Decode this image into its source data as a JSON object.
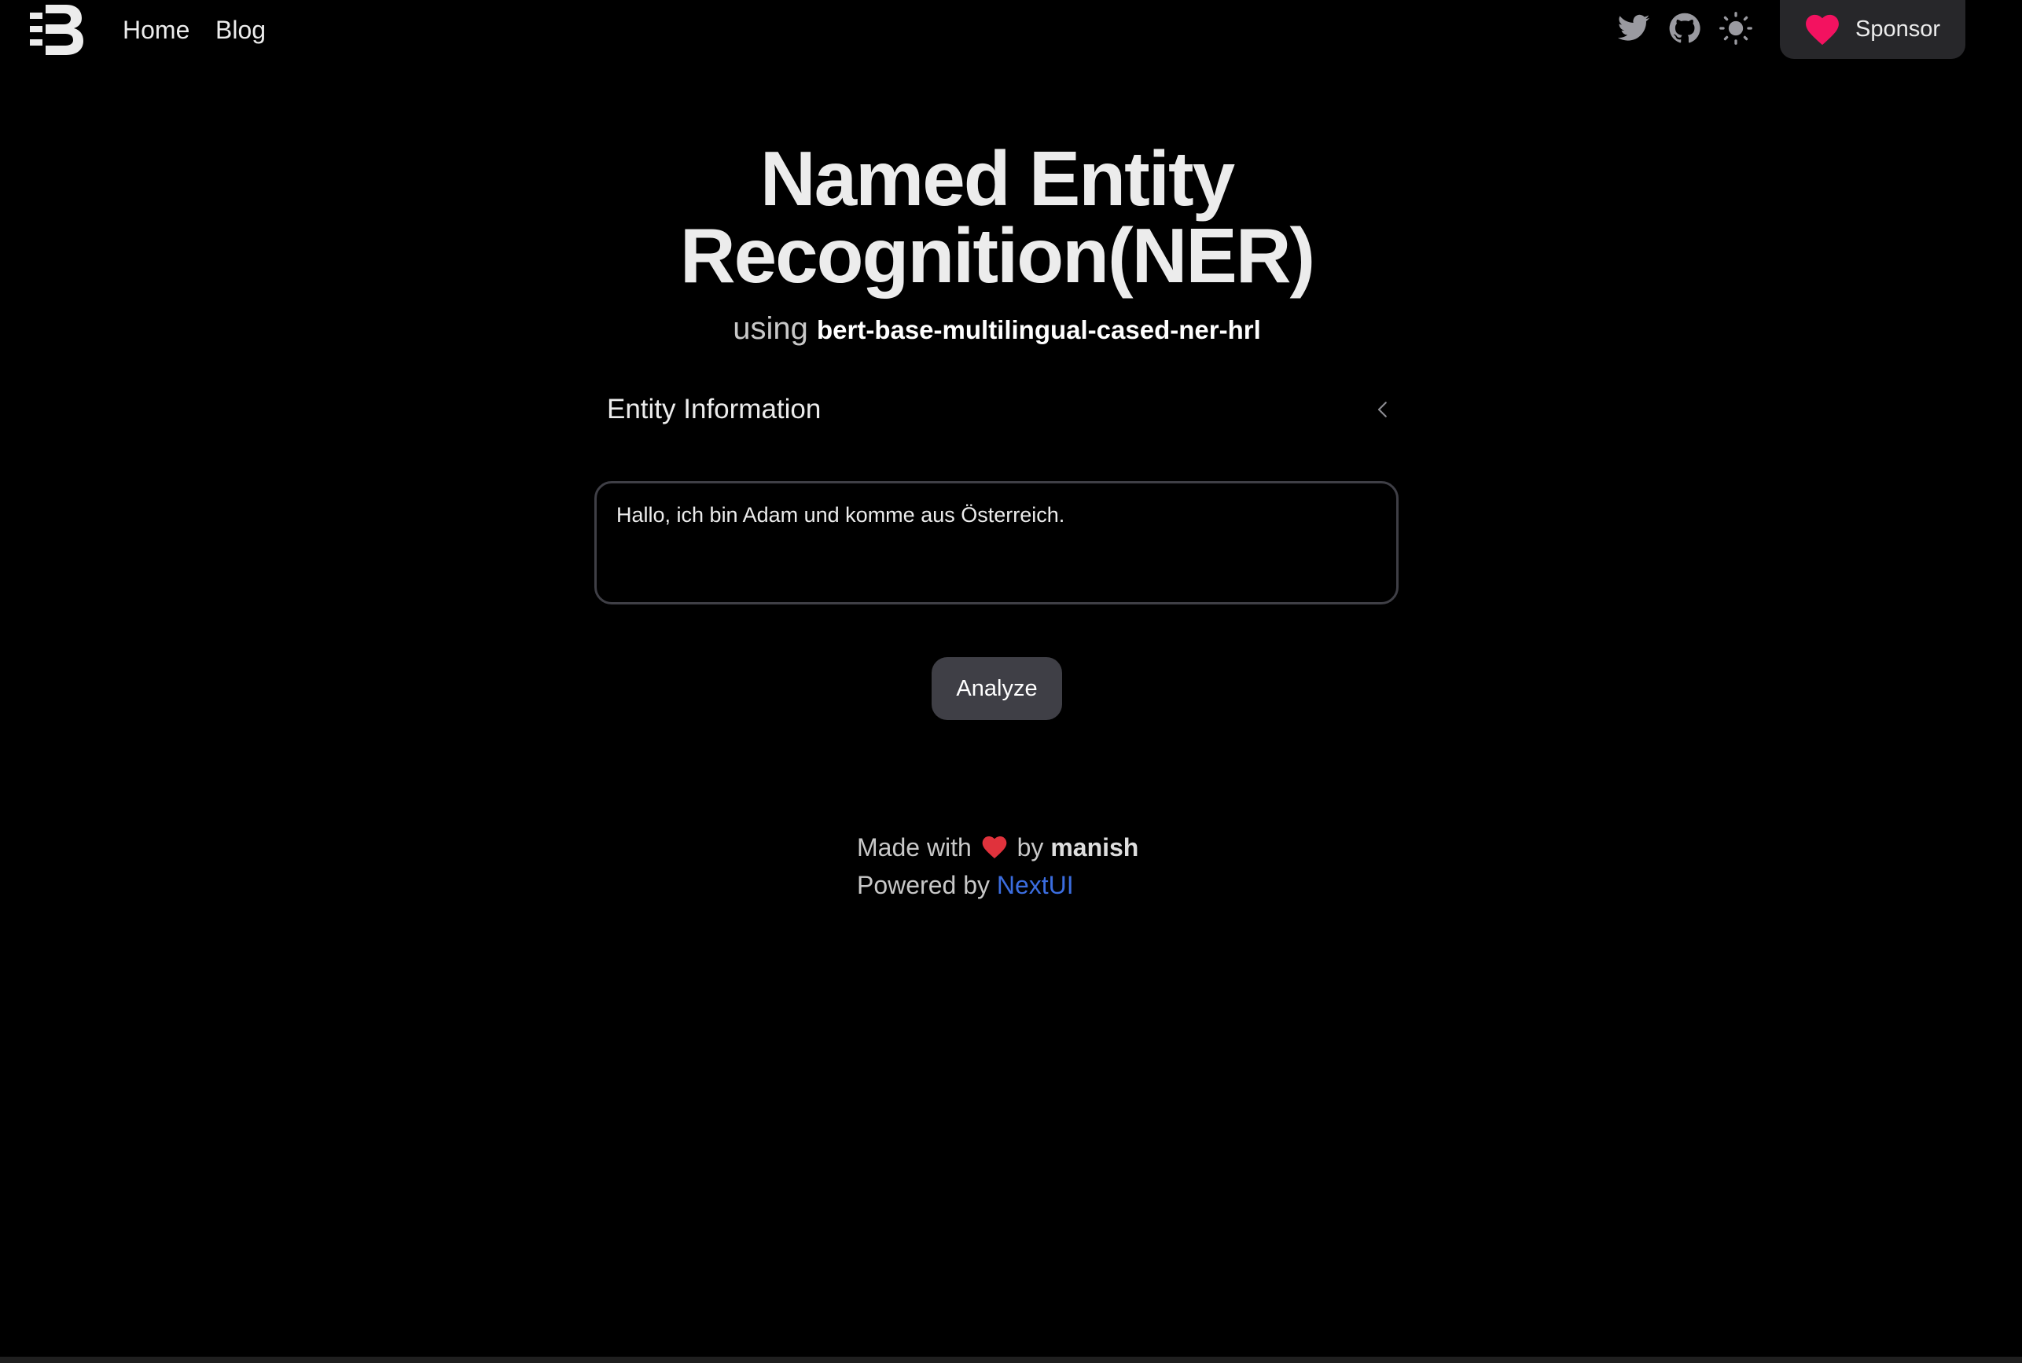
{
  "nav": {
    "links": [
      {
        "label": "Home"
      },
      {
        "label": "Blog"
      }
    ],
    "icons": [
      "twitter-icon",
      "github-icon",
      "sun-icon"
    ],
    "sponsor_label": "Sponsor"
  },
  "hero": {
    "title_line1": "Named Entity",
    "title_line2": "Recognition(NER)",
    "subtitle_prefix": "using",
    "model_name": "bert-base-multilingual-cased-ner-hrl"
  },
  "accordion": {
    "title": "Entity Information",
    "expanded": false
  },
  "input": {
    "value": "Hallo, ich bin Adam und komme aus Österreich."
  },
  "actions": {
    "analyze_label": "Analyze"
  },
  "footer": {
    "made_with": "Made with",
    "by": "by",
    "author": "manish",
    "powered_by": "Powered by",
    "framework": "NextUI"
  },
  "colors": {
    "background": "#000000",
    "surface": "#27272a",
    "button": "#3f3f46",
    "heart": "#f31260",
    "link": "#3b6ddf"
  }
}
